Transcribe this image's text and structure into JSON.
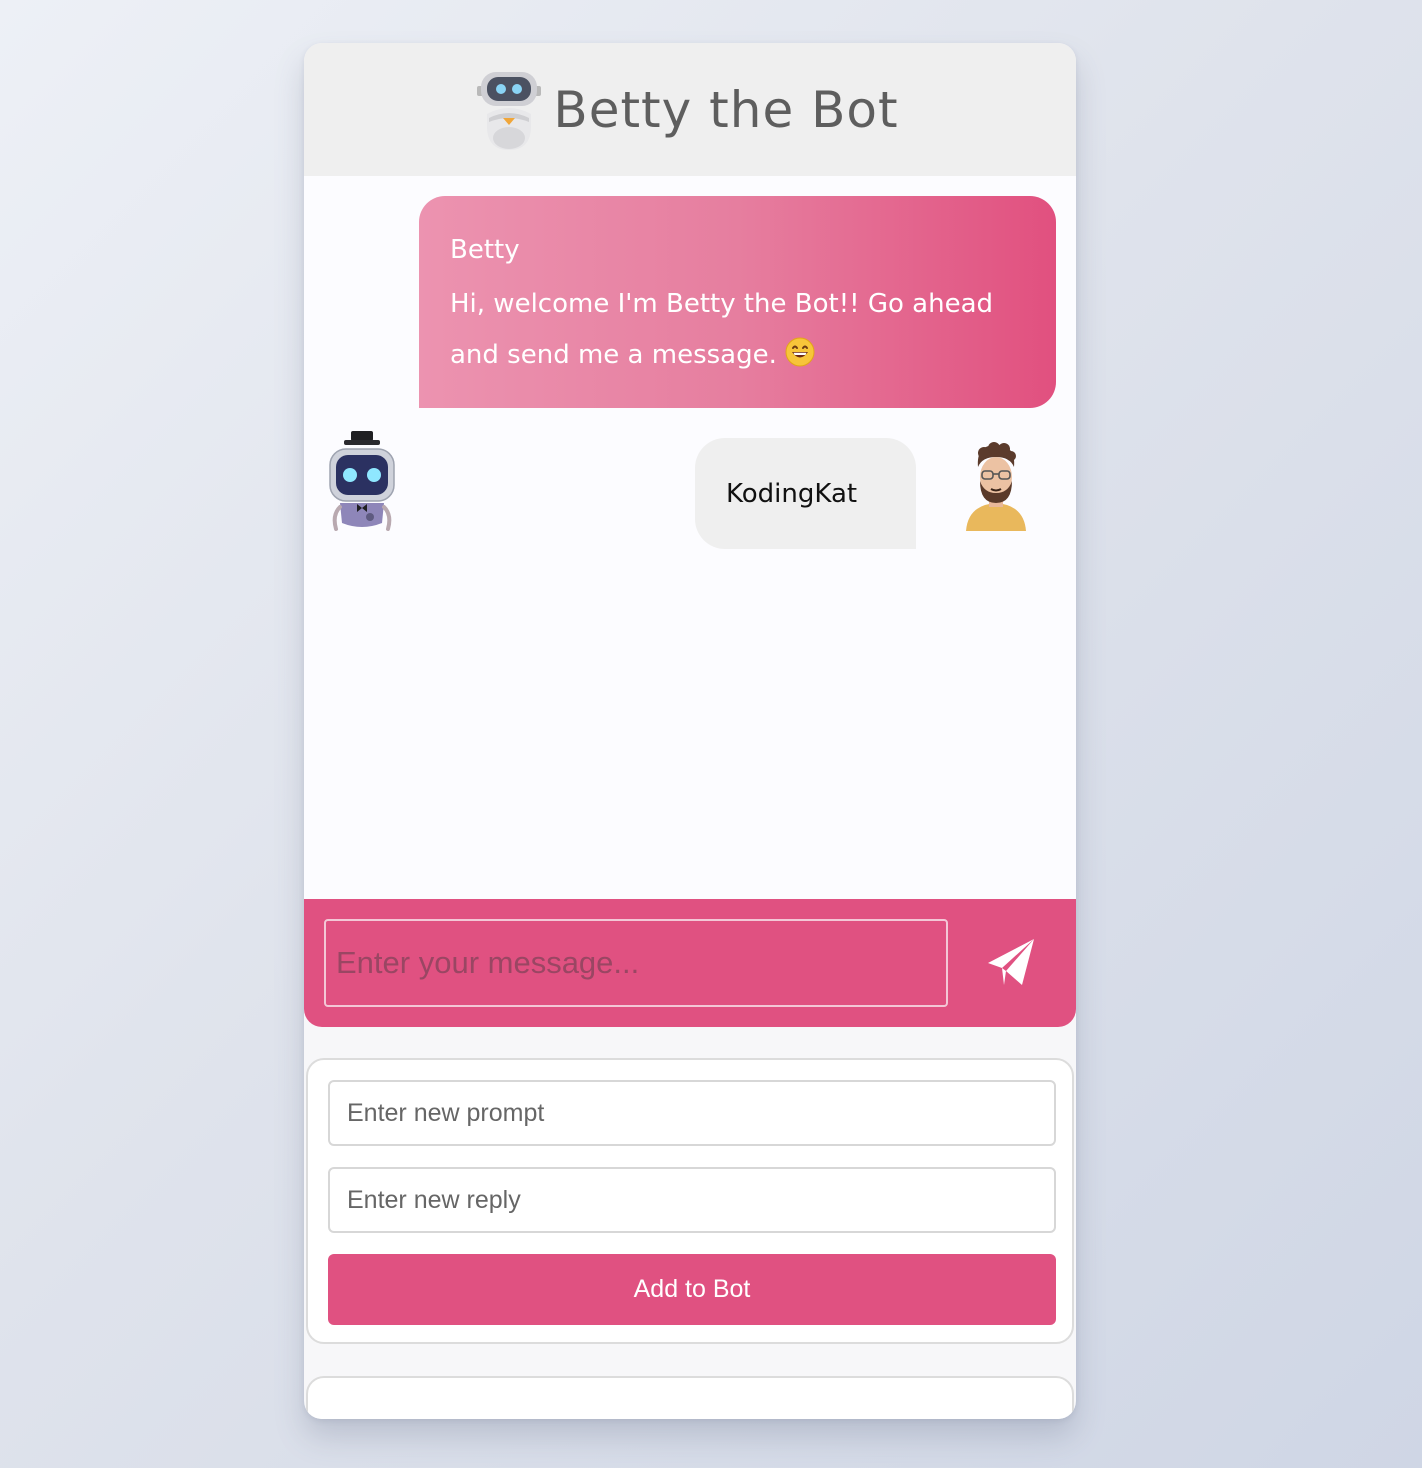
{
  "header": {
    "title": "Betty the Bot",
    "logo_icon": "robot-logo-icon"
  },
  "chat": {
    "messages": [
      {
        "sender": "Betty",
        "text": "Hi, welcome I'm Betty the Bot!! Go ahead and send me a message.",
        "emoji_icon": "grinning-face-icon",
        "avatar_icon": "robot-avatar-icon"
      },
      {
        "sender": "KodingKat",
        "text": "",
        "avatar_icon": "bearded-man-avatar-icon"
      }
    ]
  },
  "composer": {
    "placeholder": "Enter your message...",
    "send_icon": "paper-plane-icon"
  },
  "training": {
    "prompt_placeholder": "Enter new prompt",
    "reply_placeholder": "Enter new reply",
    "add_label": "Add to Bot"
  },
  "colors": {
    "accent": "#e05181",
    "header_bg": "#efefef",
    "user_bubble_bg": "#efefef"
  }
}
